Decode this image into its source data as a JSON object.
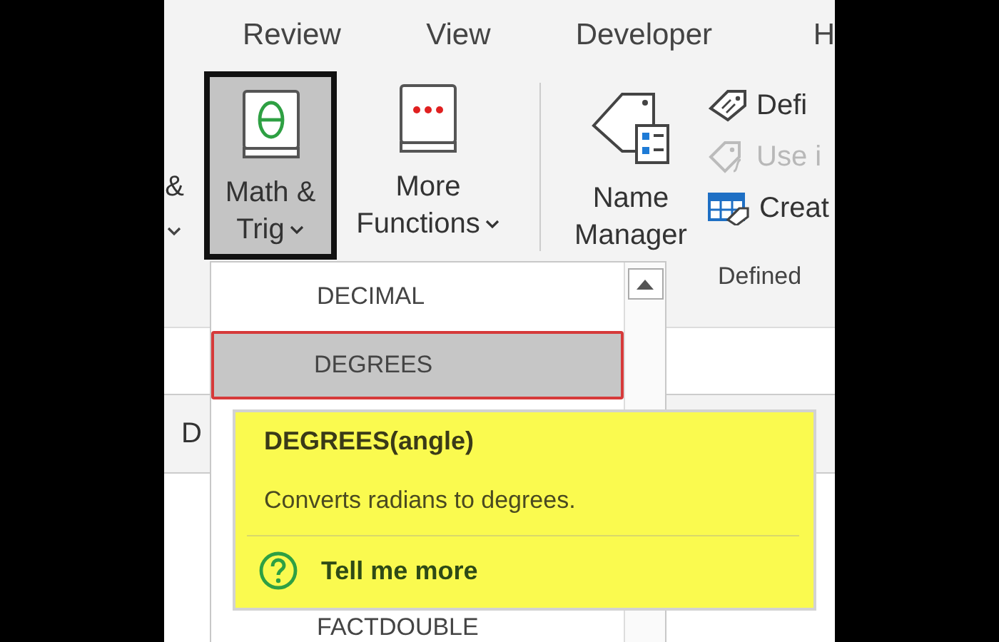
{
  "tabs": [
    {
      "label": "Review"
    },
    {
      "label": "View"
    },
    {
      "label": "Developer"
    },
    {
      "label": "H"
    }
  ],
  "ribbon": {
    "left_cut": {
      "line1": "&"
    },
    "buttons": [
      {
        "kind": "math",
        "line1": "Math &",
        "line2": "Trig",
        "selected": true
      },
      {
        "kind": "more",
        "line1": "More",
        "line2": "Functions",
        "selected": false
      },
      {
        "kind": "name",
        "line1": "Name",
        "line2": "Manager",
        "selected": false
      }
    ],
    "small_buttons": [
      {
        "kind": "define",
        "label": "Defi",
        "disabled": false
      },
      {
        "kind": "use",
        "label": "Use i",
        "disabled": true
      },
      {
        "kind": "create",
        "label": "Creat",
        "disabled": false
      }
    ],
    "group_label": "Defined"
  },
  "column_header": "D",
  "dropdown": {
    "items": [
      {
        "label": "DECIMAL",
        "selected": false
      },
      {
        "label": "DEGREES",
        "selected": true
      },
      {
        "label": "FACTDOUBLE",
        "selected": false
      }
    ]
  },
  "tooltip": {
    "title": "DEGREES(angle)",
    "description": "Converts radians to degrees.",
    "link": "Tell me more"
  }
}
